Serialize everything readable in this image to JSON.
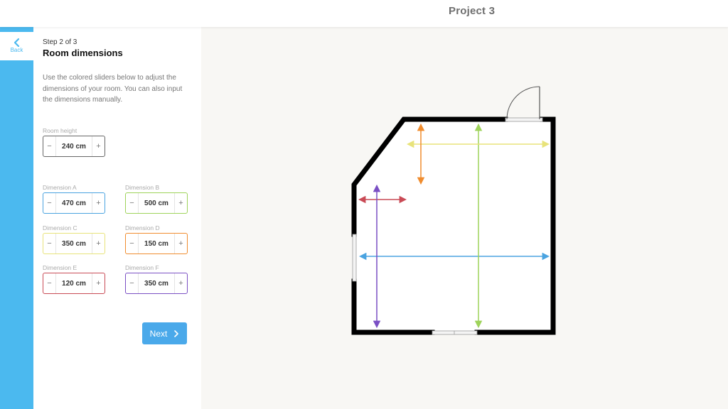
{
  "header": {
    "project_title": "Project 3"
  },
  "nav": {
    "back_label": "Back",
    "back_icon": "chevron-left-icon"
  },
  "panel": {
    "step": "Step 2 of 3",
    "title": "Room dimensions",
    "description": "Use the colored sliders below to adjust the dimensions of your room. You can also input the dimensions manually.",
    "room_height": {
      "label": "Room height",
      "value": "240 cm"
    },
    "dimensions": [
      {
        "label": "Dimension A",
        "value": "470 cm",
        "color": "#4aa3e0"
      },
      {
        "label": "Dimension B",
        "value": "500 cm",
        "color": "#9ed35a"
      },
      {
        "label": "Dimension C",
        "value": "350 cm",
        "color": "#e8e37a"
      },
      {
        "label": "Dimension D",
        "value": "150 cm",
        "color": "#f08c2e"
      },
      {
        "label": "Dimension E",
        "value": "120 cm",
        "color": "#c94a55"
      },
      {
        "label": "Dimension F",
        "value": "350 cm",
        "color": "#7a4fc4"
      }
    ],
    "minus_glyph": "−",
    "plus_glyph": "+",
    "next_label": "Next",
    "next_icon": "chevron-right-icon"
  },
  "floorplan": {
    "wall_color": "#000000",
    "door_icon": "door-swing-icon",
    "window_icon": "window-icon"
  }
}
